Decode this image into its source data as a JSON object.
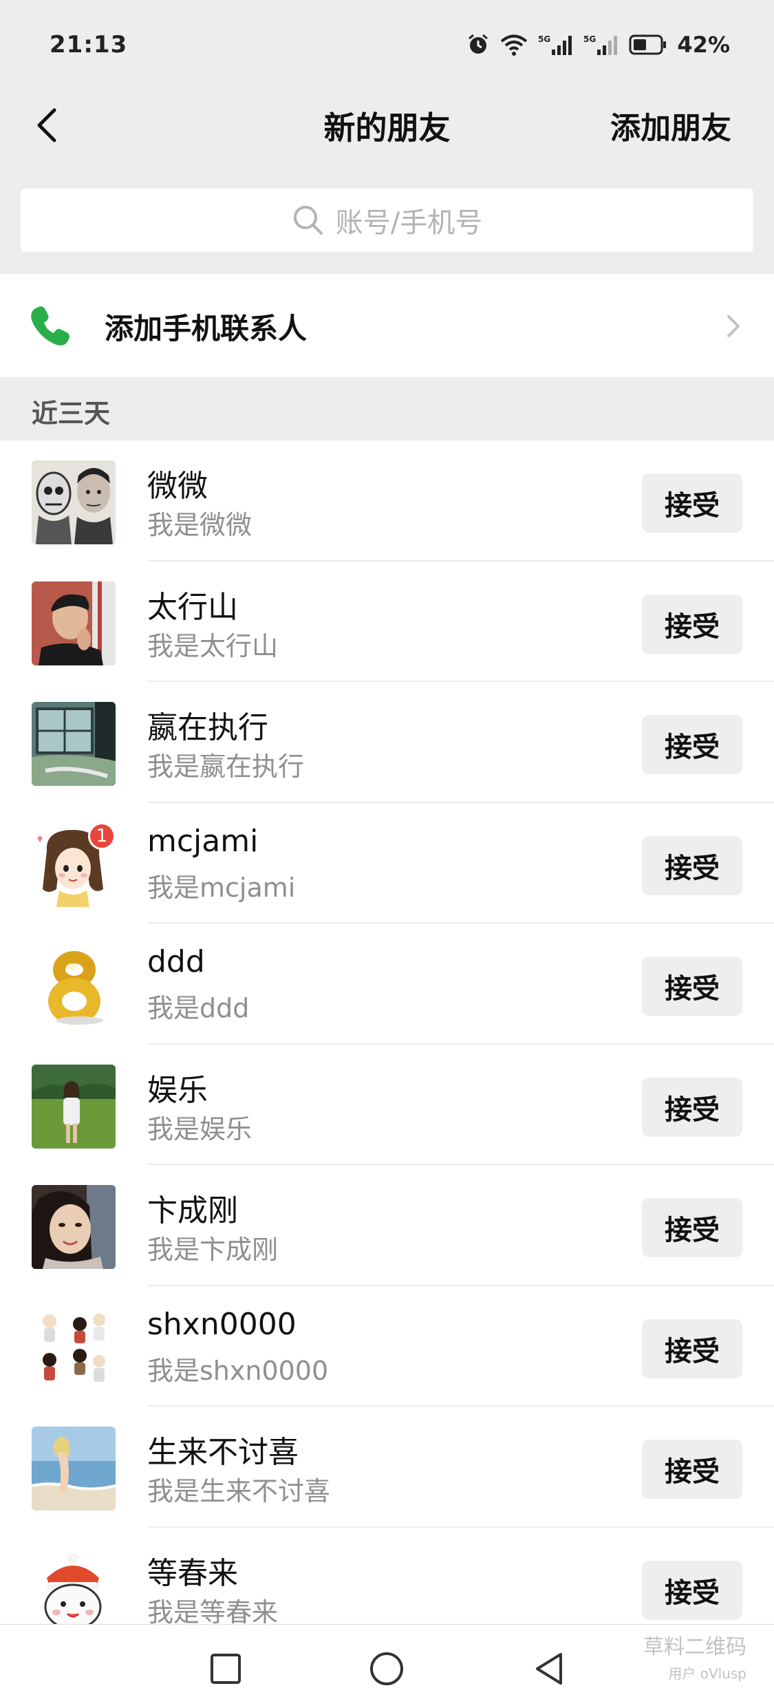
{
  "status_bar": {
    "time": "21:13",
    "battery": "42%",
    "icons": [
      "alarm-icon",
      "wifi-icon",
      "signal-5g-icon",
      "signal-5g-icon",
      "battery-icon"
    ]
  },
  "nav": {
    "title": "新的朋友",
    "action": "添加朋友"
  },
  "search": {
    "placeholder": "账号/手机号"
  },
  "phone_contacts": {
    "label": "添加手机联系人",
    "icon_color": "#2aae48"
  },
  "section": {
    "title": "近三天"
  },
  "requests": [
    {
      "name": "微微",
      "message": "我是微微",
      "action": "接受"
    },
    {
      "name": "太行山",
      "message": "我是太行山",
      "action": "接受"
    },
    {
      "name": "嬴在执行",
      "message": "我是嬴在执行",
      "action": "接受"
    },
    {
      "name": "mcjami",
      "message": "我是mcjami",
      "action": "接受",
      "badge": "1"
    },
    {
      "name": "ddd",
      "message": "我是ddd",
      "action": "接受"
    },
    {
      "name": "娱乐",
      "message": "我是娱乐",
      "action": "接受"
    },
    {
      "name": "卞成刚",
      "message": "我是卞成刚",
      "action": "接受"
    },
    {
      "name": "shxn0000",
      "message": "我是shxn0000",
      "action": "接受"
    },
    {
      "name": "生来不讨喜",
      "message": "我是生来不讨喜",
      "action": "接受"
    },
    {
      "name": "等春来",
      "message": "我是等春来",
      "action": "接受"
    }
  ],
  "watermark": {
    "line1": "草料二维码",
    "line2": "用户 oVlusp"
  },
  "colors": {
    "accent_green": "#2aae48",
    "badge_red": "#e8463c",
    "background": "#ededed"
  }
}
